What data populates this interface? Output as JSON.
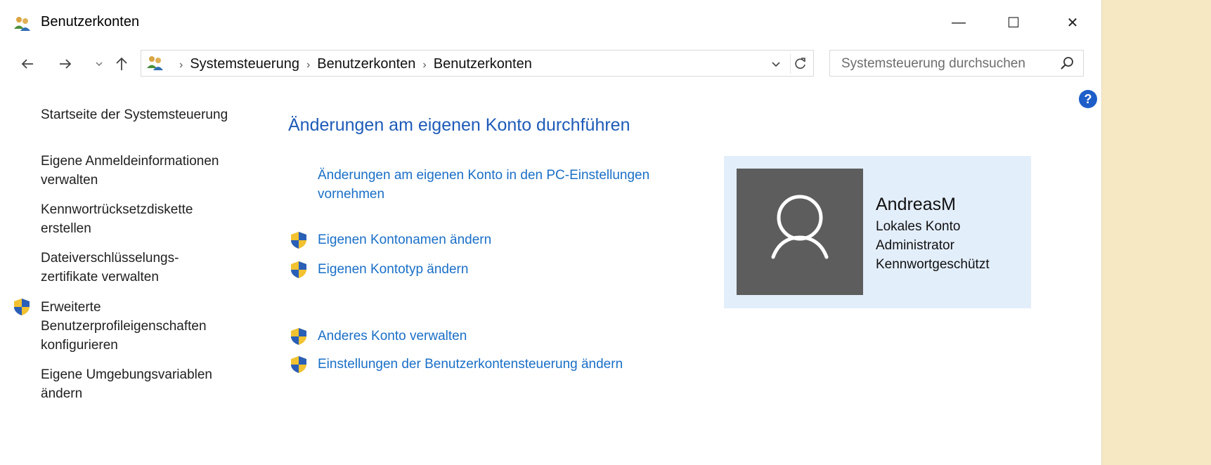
{
  "window": {
    "title": "Benutzerkonten",
    "controls": {
      "minimize": "—",
      "maximize": "☐",
      "close": "✕"
    }
  },
  "navigation": {
    "back_icon": "arrow-left-icon",
    "forward_icon": "arrow-right-icon",
    "recent_icon": "chevron-down-icon",
    "up_icon": "arrow-up-icon",
    "breadcrumbs": [
      "Systemsteuerung",
      "Benutzerkonten",
      "Benutzerkonten"
    ],
    "separator": "›"
  },
  "search": {
    "placeholder": "Systemsteuerung durchsuchen"
  },
  "help": {
    "label": "?"
  },
  "sidebar": {
    "items": [
      {
        "label": "Startseite der Systemsteuerung",
        "shield": false
      },
      {
        "label": "Eigene Anmeldeinformationen verwalten",
        "shield": false
      },
      {
        "label": "Kennwortrücksetzdiskette erstellen",
        "shield": false
      },
      {
        "label": "Dateiverschlüsselungs- zertifikate verwalten",
        "shield": false
      },
      {
        "label": "Erweiterte Benutzerprofileigenschaften konfigurieren",
        "shield": true
      },
      {
        "label": "Eigene Umgebungsvariablen ändern",
        "shield": false
      }
    ]
  },
  "main": {
    "title": "Änderungen am eigenen Konto durchführen",
    "links": [
      {
        "label": "Änderungen am eigenen Konto in den PC-Einstellungen vornehmen",
        "shield": false
      },
      {
        "label": "Eigenen Kontonamen ändern",
        "shield": true
      },
      {
        "label": "Eigenen Kontotyp ändern",
        "shield": true
      },
      {
        "label": "Anderes Konto verwalten",
        "shield": true
      },
      {
        "label": "Einstellungen der Benutzerkontensteuerung ändern",
        "shield": true
      }
    ]
  },
  "account": {
    "name": "AndreasM",
    "details": [
      "Lokales Konto",
      "Administrator",
      "Kennwortgeschützt"
    ],
    "avatar_icon": "user-silhouette-icon"
  },
  "colors": {
    "link": "#1a6fc7",
    "title": "#1e5bb8",
    "card_bg": "#e3eefb",
    "avatar_bg": "#5d5d5d",
    "help": "#1e5ec9"
  }
}
